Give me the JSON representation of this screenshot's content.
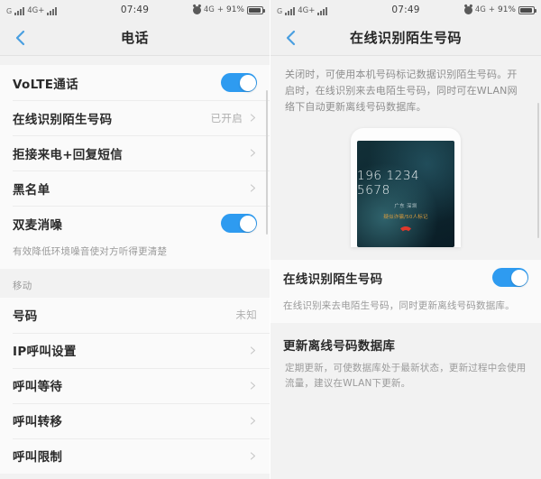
{
  "status_bar": {
    "carrier_prefix": "G",
    "network": "4G+",
    "time": "07:49",
    "network_right": "4G",
    "network_right_sup": "2",
    "network_right_plus": "+",
    "battery_percent": "91%",
    "alarm_icon": "alarm-icon",
    "battery_icon": "battery-icon",
    "signal_icon": "signal-bars-icon"
  },
  "left_screen": {
    "nav": {
      "title": "电话",
      "back_icon": "back-chevron-icon"
    },
    "group1": [
      {
        "label": "VoLTE通话",
        "type": "toggle",
        "on": true
      },
      {
        "label": "在线识别陌生号码",
        "type": "link",
        "value": "已开启"
      },
      {
        "label": "拒接来电+回复短信",
        "type": "link",
        "value": ""
      },
      {
        "label": "黑名单",
        "type": "link",
        "value": ""
      },
      {
        "label": "双麦消噪",
        "type": "toggle",
        "on": true
      }
    ],
    "group1_note": "有效降低环境噪音使对方听得更清楚",
    "section_title": "移动",
    "group2": [
      {
        "label": "号码",
        "type": "value",
        "value": "未知"
      },
      {
        "label": "IP呼叫设置",
        "type": "link",
        "value": ""
      },
      {
        "label": "呼叫等待",
        "type": "link",
        "value": ""
      },
      {
        "label": "呼叫转移",
        "type": "link",
        "value": ""
      },
      {
        "label": "呼叫限制",
        "type": "link",
        "value": ""
      }
    ]
  },
  "right_screen": {
    "nav": {
      "title": "在线识别陌生号码",
      "back_icon": "back-chevron-icon"
    },
    "description": "关闭时，可使用本机号码标记数据识别陌生号码。开启时，在线识别来去电陌生号码，同时可在WLAN网络下自动更新离线号码数据库。",
    "illustration": {
      "name": "incoming-call-preview",
      "phone_number": "196 1234 5678",
      "location": "广东 深圳",
      "tag": "疑似诈骗/50人标记",
      "hangup_icon": "hangup-icon",
      "hangup_color": "#e0392b"
    },
    "toggle_row": {
      "label": "在线识别陌生号码",
      "on": true
    },
    "toggle_note": "在线识别来去电陌生号码，同时更新离线号码数据库。",
    "update_title": "更新离线号码数据库",
    "update_desc": "定期更新，可使数据库处于最新状态，更新过程中会使用流量，建议在WLAN下更新。"
  },
  "colors": {
    "accent_toggle": "#2e9bf0",
    "back_arrow": "#4a9fe0",
    "page_bg": "#f2f2f2",
    "card_bg": "#fafafa",
    "hangup_red": "#e0392b",
    "tag_orange": "#d79a3c"
  }
}
